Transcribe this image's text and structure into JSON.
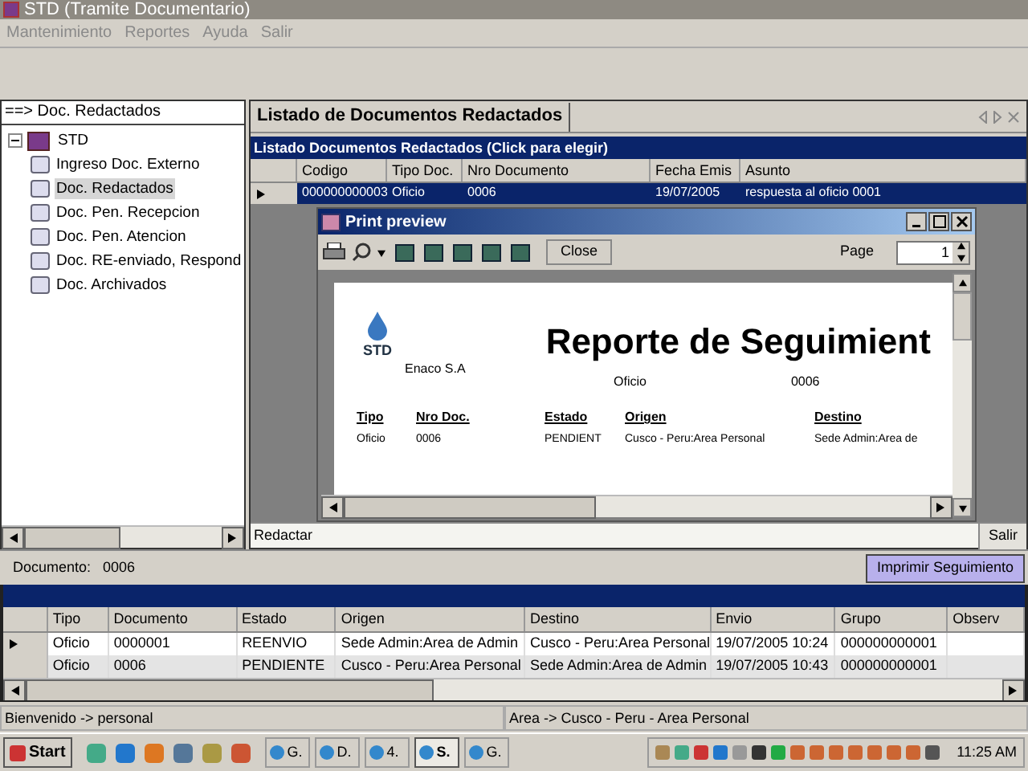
{
  "window": {
    "title": "STD (Tramite Documentario)"
  },
  "menu": [
    "Mantenimiento",
    "Reportes",
    "Ayuda",
    "Salir"
  ],
  "tree": {
    "header": "==> Doc. Redactados",
    "items": [
      {
        "label": "STD",
        "expanded": true,
        "selected": false,
        "children": [
          {
            "label": "Ingreso Doc. Externo",
            "selected": false
          },
          {
            "label": "Doc. Redactados",
            "selected": true
          },
          {
            "label": "Doc. Pen. Recepcion",
            "selected": false
          },
          {
            "label": "Doc. Pen. Atencion",
            "selected": false
          },
          {
            "label": "Doc. RE-enviado, Respond",
            "selected": false
          },
          {
            "label": "Doc. Archivados",
            "selected": false
          }
        ]
      }
    ]
  },
  "documents_tab": {
    "label": "Listado de Documentos Redactados",
    "selected": true
  },
  "documents_grid": {
    "caption": "Listado Documentos Redactados (Click para elegir)",
    "columns": [
      "Codigo",
      "Tipo Doc.",
      "Nro Documento",
      "Fecha Emis",
      "Asunto"
    ],
    "rows": [
      {
        "current": true,
        "selected": true,
        "cells": [
          "000000000003",
          "Oficio",
          "0006",
          "19/07/2005",
          "respuesta al oficio 0001"
        ]
      }
    ]
  },
  "bottom_tab": {
    "label": "Redactar"
  },
  "exit_button": "Salir",
  "print_preview": {
    "title": "Print preview",
    "close_button": "Close",
    "page_label": "Page",
    "page_value": "1",
    "report": {
      "logo_text": "STD",
      "company": "Enaco S.A",
      "title": "Reporte de Seguimient",
      "doc_type": "Oficio",
      "doc_number": "0006",
      "columns": [
        "Tipo",
        "Nro Doc.",
        "Estado",
        "Origen",
        "Destino"
      ],
      "row": [
        "Oficio",
        "0006",
        "PENDIENT",
        "Cusco - Peru:Area Personal",
        "Sede Admin:Area de"
      ]
    }
  },
  "document_bar": {
    "label": "Documento:",
    "value": "0006",
    "button": "Imprimir Seguimiento"
  },
  "tracking_grid": {
    "columns": [
      "Tipo",
      "Documento",
      "Estado",
      "Origen",
      "Destino",
      "Envio",
      "Grupo",
      "Observ"
    ],
    "rows": [
      {
        "current": true,
        "cells": [
          "Oficio",
          "0000001",
          "REENVIO",
          "Sede Admin:Area de Admin",
          "Cusco - Peru:Area Personal",
          "19/07/2005 10:24",
          "000000000001",
          ""
        ]
      },
      {
        "current": false,
        "cells": [
          "Oficio",
          "0006",
          "PENDIENTE",
          "Cusco - Peru:Area Personal",
          "Sede Admin:Area de Admin",
          "19/07/2005 10:43",
          "000000000001",
          ""
        ]
      }
    ]
  },
  "status_bar": [
    "Bienvenido -> personal",
    "Area -> Cusco - Peru - Area Personal"
  ],
  "taskbar": {
    "start": "Start",
    "tasks": [
      {
        "label": "G.",
        "selected": false
      },
      {
        "label": "D.",
        "selected": false
      },
      {
        "label": "4.",
        "selected": false
      },
      {
        "label": "S.",
        "selected": true
      },
      {
        "label": "G.",
        "selected": false
      }
    ],
    "clock": "11:25 AM"
  }
}
